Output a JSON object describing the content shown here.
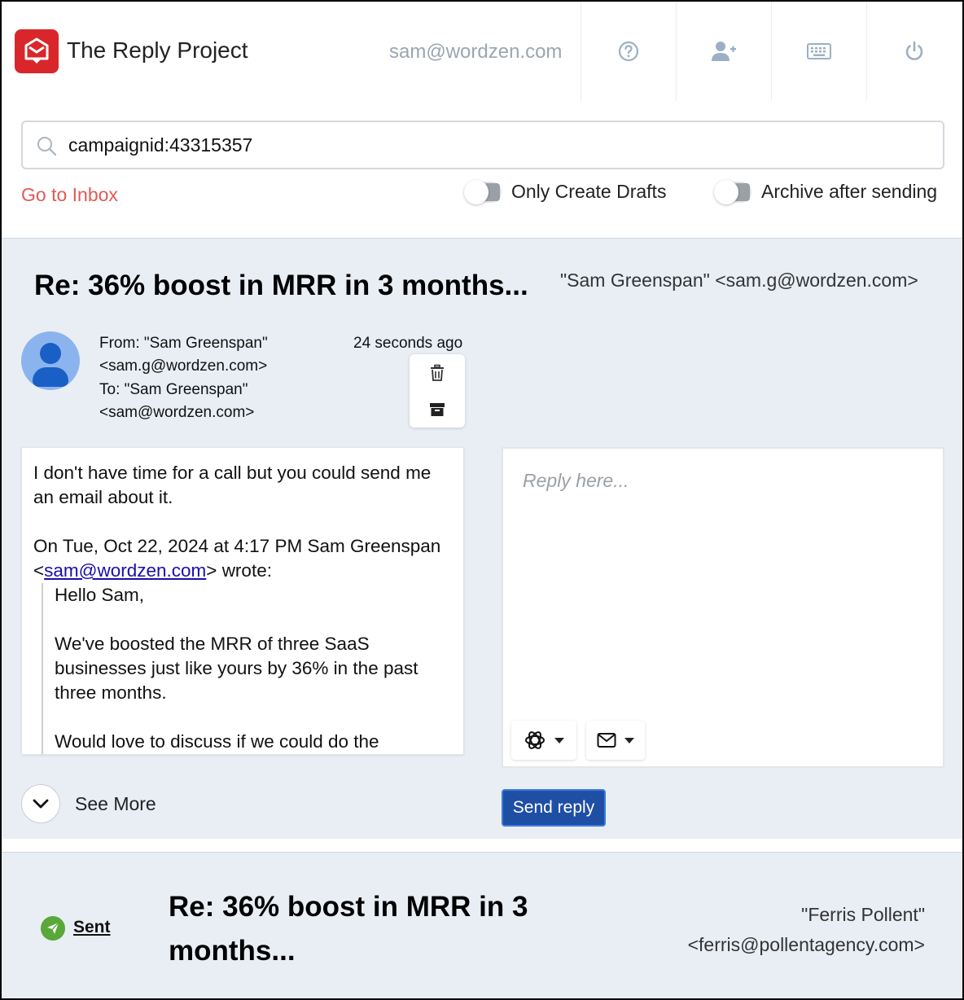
{
  "app": {
    "title": "The Reply Project",
    "user_email": "sam@wordzen.com",
    "accent_color": "#d8262b"
  },
  "header_icons": [
    "help-icon",
    "add-user-icon",
    "keyboard-icon",
    "power-icon"
  ],
  "search": {
    "value": "campaignid:43315357",
    "icon": "search-icon"
  },
  "controls": {
    "go_to_inbox": "Go to Inbox",
    "only_create_drafts": "Only Create Drafts",
    "archive_after_sending": "Archive after sending"
  },
  "thread": {
    "subject": "Re: 36% boost in MRR in 3 months...",
    "to_address": "\"Sam Greenspan\" <sam.g@wordzen.com>",
    "from_line1": "From: \"Sam Greenspan\"",
    "from_line2": "<sam.g@wordzen.com>",
    "to_line1": "To: \"Sam Greenspan\"",
    "to_line2": "<sam@wordzen.com>",
    "timestamp": "24 seconds ago",
    "message": {
      "line1": "I don't have time for a call but you could send me an email about it.",
      "quote_header_pre": "On Tue, Oct 22, 2024 at 4:17 PM Sam Greenspan <",
      "quote_link": "sam@wordzen.com",
      "quote_header_post": "> wrote:",
      "quote_greeting": "Hello Sam,",
      "quote_body": "We've boosted the MRR of three SaaS businesses just like yours by 36% in the past three months.",
      "quote_cta": "Would love to discuss if we could do the"
    },
    "see_more": "See More",
    "reply_placeholder": "Reply here...",
    "send_reply": "Send reply"
  },
  "thread2": {
    "status": "Sent",
    "subject": "Re: 36% boost in MRR in 3 months...",
    "from_name": "\"Ferris Pollent\"",
    "from_email": "<ferris@pollentagency.com>"
  }
}
